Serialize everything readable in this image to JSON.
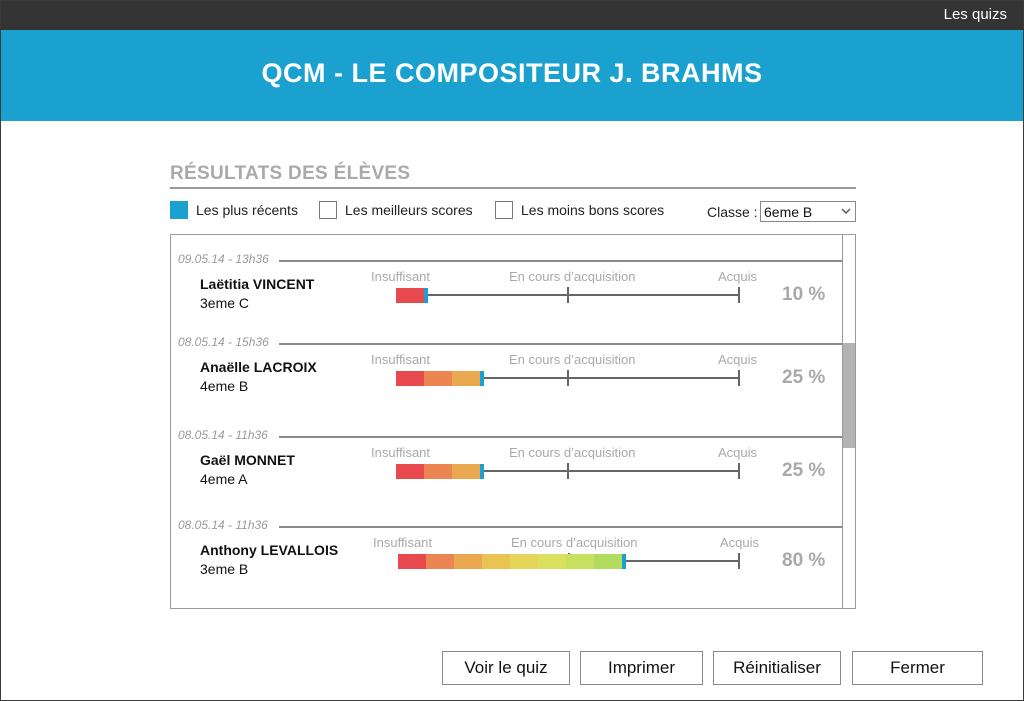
{
  "topbar": {
    "link_label": "Les quizs"
  },
  "header": {
    "title": "QCM - LE COMPOSITEUR J. BRAHMS"
  },
  "results": {
    "title": "RÉSULTATS DES ÉLÈVES"
  },
  "filters": [
    {
      "label": "Les plus récents",
      "checked": true
    },
    {
      "label": "Les meilleurs scores",
      "checked": false
    },
    {
      "label": "Les moins bons scores",
      "checked": false
    }
  ],
  "class_filter": {
    "label": "Classe :",
    "value": "6eme B"
  },
  "levels": {
    "low": "Insuffisant",
    "mid": "En cours d’acquisition",
    "high": "Acquis"
  },
  "colors": {
    "accent": "#1ba1cf",
    "scale": [
      "#e8494f",
      "#eb8551",
      "#eaa850",
      "#e9c452",
      "#e5d558",
      "#dbe05e",
      "#c8e05f",
      "#b1dc60",
      "#9fd464",
      "#8fcb62"
    ]
  },
  "students": [
    {
      "date": "09.05.14 - 13h36",
      "name": "Laëtitia VINCENT",
      "class": "3eme C",
      "score_pct": 10,
      "score_label": "10 %"
    },
    {
      "date": "08.05.14 - 15h36",
      "name": "Anaëlle LACROIX",
      "class": "4eme B",
      "score_pct": 25,
      "score_label": "25 %"
    },
    {
      "date": "08.05.14 - 11h36",
      "name": "Gaël MONNET",
      "class": "4eme A",
      "score_pct": 25,
      "score_label": "25 %"
    },
    {
      "date": "08.05.14 - 11h36",
      "name": "Anthony LEVALLOIS",
      "class": "3eme B",
      "score_pct": 80,
      "score_label": "80 %"
    }
  ],
  "buttons": {
    "view_quiz": "Voir le quiz",
    "print": "Imprimer",
    "reset": "Réinitialiser",
    "close": "Fermer"
  }
}
